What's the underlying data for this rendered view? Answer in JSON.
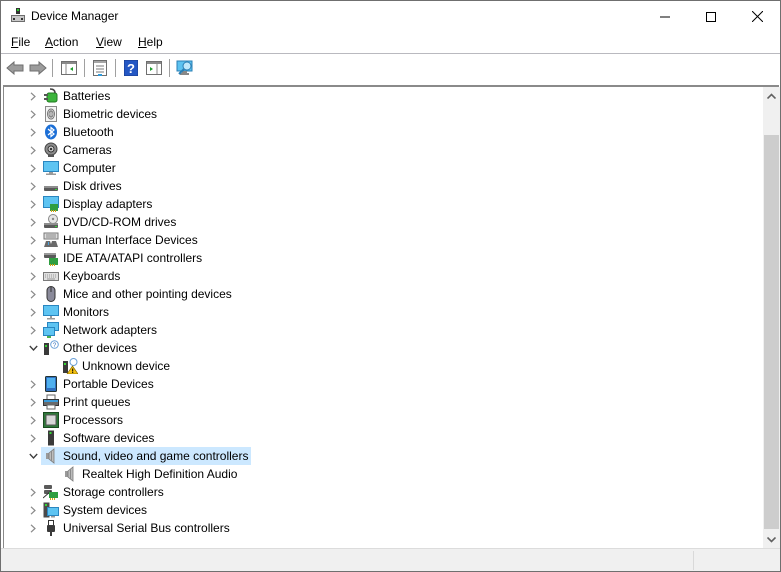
{
  "window": {
    "title": "Device Manager",
    "controls": {
      "minimize": "minimize",
      "maximize": "maximize",
      "close": "close"
    }
  },
  "menu": [
    {
      "label": "File",
      "mnemonic": "F",
      "rest": "ile"
    },
    {
      "label": "Action",
      "mnemonic": "A",
      "rest": "ction"
    },
    {
      "label": "View",
      "mnemonic": "V",
      "rest": "iew"
    },
    {
      "label": "Help",
      "mnemonic": "H",
      "rest": "elp"
    }
  ],
  "toolbar": [
    {
      "name": "back",
      "icon": "back-arrow-icon",
      "enabled": false
    },
    {
      "name": "forward",
      "icon": "forward-arrow-icon",
      "enabled": false
    },
    {
      "name": "show-hide-console-tree",
      "icon": "console-tree-icon"
    },
    {
      "name": "properties",
      "icon": "properties-icon"
    },
    {
      "name": "help",
      "icon": "help-icon"
    },
    {
      "name": "show-hide-action-pane",
      "icon": "action-pane-icon"
    },
    {
      "name": "scan-for-hardware-changes",
      "icon": "scan-monitor-icon"
    }
  ],
  "tree": {
    "items": [
      {
        "label": "Batteries",
        "icon": "battery-icon",
        "level": 0,
        "expanded": false
      },
      {
        "label": "Biometric devices",
        "icon": "fingerprint-icon",
        "level": 0,
        "expanded": false
      },
      {
        "label": "Bluetooth",
        "icon": "bluetooth-icon",
        "level": 0,
        "expanded": false
      },
      {
        "label": "Cameras",
        "icon": "camera-icon",
        "level": 0,
        "expanded": false
      },
      {
        "label": "Computer",
        "icon": "computer-icon",
        "level": 0,
        "expanded": false
      },
      {
        "label": "Disk drives",
        "icon": "disk-drive-icon",
        "level": 0,
        "expanded": false
      },
      {
        "label": "Display adapters",
        "icon": "display-adapter-icon",
        "level": 0,
        "expanded": false
      },
      {
        "label": "DVD/CD-ROM drives",
        "icon": "dvd-drive-icon",
        "level": 0,
        "expanded": false
      },
      {
        "label": "Human Interface Devices",
        "icon": "hid-icon",
        "level": 0,
        "expanded": false
      },
      {
        "label": "IDE ATA/ATAPI controllers",
        "icon": "ide-controller-icon",
        "level": 0,
        "expanded": false
      },
      {
        "label": "Keyboards",
        "icon": "keyboard-icon",
        "level": 0,
        "expanded": false
      },
      {
        "label": "Mice and other pointing devices",
        "icon": "mouse-icon",
        "level": 0,
        "expanded": false
      },
      {
        "label": "Monitors",
        "icon": "monitor-icon",
        "level": 0,
        "expanded": false
      },
      {
        "label": "Network adapters",
        "icon": "network-adapter-icon",
        "level": 0,
        "expanded": false
      },
      {
        "label": "Other devices",
        "icon": "other-devices-icon",
        "level": 0,
        "expanded": true
      },
      {
        "label": "Unknown device",
        "icon": "unknown-device-warning-icon",
        "level": 1
      },
      {
        "label": "Portable Devices",
        "icon": "portable-device-icon",
        "level": 0,
        "expanded": false
      },
      {
        "label": "Print queues",
        "icon": "printer-icon",
        "level": 0,
        "expanded": false
      },
      {
        "label": "Processors",
        "icon": "processor-icon",
        "level": 0,
        "expanded": false
      },
      {
        "label": "Software devices",
        "icon": "software-device-icon",
        "level": 0,
        "expanded": false
      },
      {
        "label": "Sound, video and game controllers",
        "icon": "speaker-icon",
        "level": 0,
        "expanded": true,
        "selected": true
      },
      {
        "label": "Realtek High Definition Audio",
        "icon": "speaker-icon",
        "level": 1
      },
      {
        "label": "Storage controllers",
        "icon": "storage-controller-icon",
        "level": 0,
        "expanded": false
      },
      {
        "label": "System devices",
        "icon": "system-devices-icon",
        "level": 0,
        "expanded": false
      },
      {
        "label": "Universal Serial Bus controllers",
        "icon": "usb-icon",
        "level": 0,
        "expanded": false
      }
    ]
  },
  "colors": {
    "selection": "#cce8ff",
    "scroll_thumb": "#cdcdcd",
    "statusbar": "#f0f0f0"
  },
  "statusbar": {
    "panes": [
      "",
      ""
    ]
  }
}
